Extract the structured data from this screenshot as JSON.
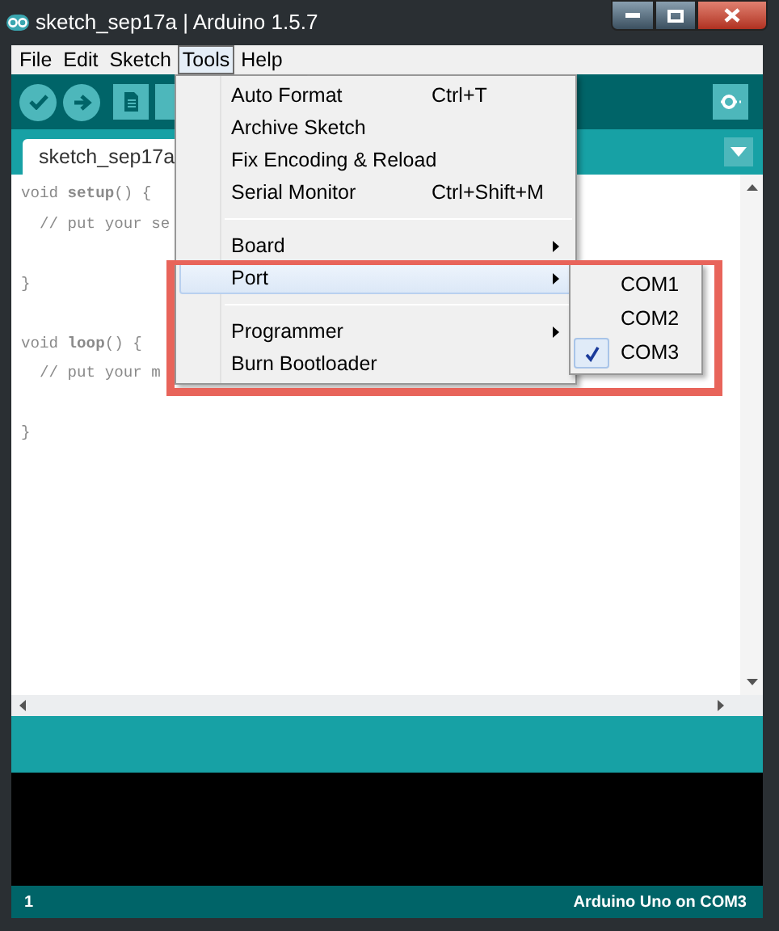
{
  "window": {
    "title": "sketch_sep17a | Arduino 1.5.7"
  },
  "menu_bar": [
    {
      "label": "File",
      "selected": false
    },
    {
      "label": "Edit",
      "selected": false
    },
    {
      "label": "Sketch",
      "selected": false
    },
    {
      "label": "Tools",
      "selected": true
    },
    {
      "label": "Help",
      "selected": false
    }
  ],
  "tabs": [
    {
      "label": "sketch_sep17a",
      "selected": true
    }
  ],
  "code_blocks": [
    [
      "void **setup**() {",
      "  // put your se"
    ],
    [
      "}"
    ],
    [
      "void **loop**() {",
      "  // put your m"
    ],
    [
      "}"
    ]
  ],
  "tools_menu": [
    {
      "kind": "item",
      "label": "Auto Format",
      "shortcut": "Ctrl+T",
      "selected": false
    },
    {
      "kind": "item",
      "label": "Archive Sketch",
      "selected": false
    },
    {
      "kind": "item",
      "label": "Fix Encoding & Reload",
      "selected": false
    },
    {
      "kind": "item",
      "label": "Serial Monitor",
      "shortcut": "Ctrl+Shift+M",
      "selected": false
    },
    {
      "kind": "separator"
    },
    {
      "kind": "submenu",
      "label": "Board",
      "selected": false
    },
    {
      "kind": "submenu",
      "label": "Port",
      "selected": true
    },
    {
      "kind": "separator"
    },
    {
      "kind": "submenu",
      "label": "Programmer",
      "selected": false
    },
    {
      "kind": "item",
      "label": "Burn Bootloader",
      "selected": false
    }
  ],
  "port_submenu": [
    {
      "label": "COM1",
      "checked": false
    },
    {
      "label": "COM2",
      "checked": false
    },
    {
      "label": "COM3",
      "checked": true
    }
  ],
  "status_bar": {
    "line": "1",
    "board": "Arduino Uno on COM3"
  }
}
